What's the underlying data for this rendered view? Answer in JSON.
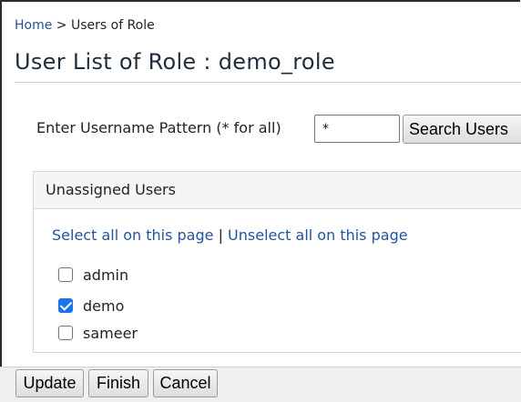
{
  "breadcrumb": {
    "home": "Home",
    "separator": " > ",
    "current": "Users of Role"
  },
  "page": {
    "title": "User List of Role : demo_role"
  },
  "search": {
    "label": "Enter Username Pattern (* for all)",
    "value": "*",
    "button_label": "Search Users"
  },
  "panel": {
    "heading": "Unassigned Users",
    "select_all": "Select all on this page",
    "divider": " | ",
    "unselect_all": "Unselect all on this page",
    "users": [
      {
        "name": "admin",
        "checked": false
      },
      {
        "name": "demo",
        "checked": true
      },
      {
        "name": "sameer",
        "checked": false
      }
    ]
  },
  "actions": {
    "update": "Update",
    "finish": "Finish",
    "cancel": "Cancel"
  },
  "colors": {
    "link": "#23539e",
    "checkbox_checked": "#1a73e8"
  }
}
